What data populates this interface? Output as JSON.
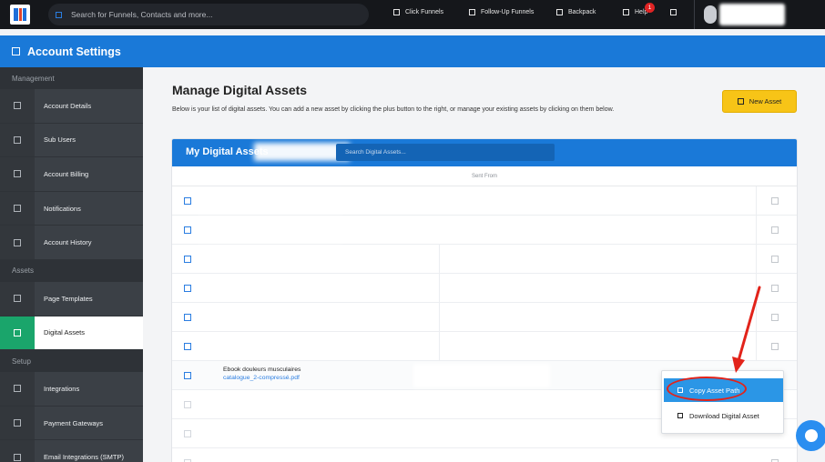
{
  "topnav": {
    "search_placeholder": "Search for Funnels, Contacts and more...",
    "items": [
      "Click Funnels",
      "Follow-Up Funnels",
      "Backpack",
      "Help",
      ""
    ],
    "help_badge": "1"
  },
  "header": {
    "title": "Account Settings"
  },
  "sidebar": {
    "sections": [
      {
        "label": "Management",
        "items": [
          "Account Details",
          "Sub Users",
          "Account Billing",
          "Notifications",
          "Account History"
        ]
      },
      {
        "label": "Assets",
        "items": [
          "Page Templates",
          "Digital Assets"
        ]
      },
      {
        "label": "Setup",
        "items": [
          "Integrations",
          "Payment Gateways",
          "Email Integrations (SMTP)"
        ]
      }
    ],
    "active": "Digital Assets"
  },
  "main": {
    "title": "Manage Digital Assets",
    "description": "Below is your list of digital assets. You can add a new asset by clicking the plus button to the right, or manage your existing assets by clicking on them below.",
    "new_asset_label": "New Asset"
  },
  "assets": {
    "card_title": "My Digital Assets",
    "search_placeholder": "Search Digital Assets...",
    "column_header": "Sent From",
    "file_name": "Ebook douleurs musculaires",
    "file_link": "catalogue_2-compressé.pdf"
  },
  "menu": {
    "copy_path": "Copy Asset Path",
    "download": "Download Digital Asset"
  },
  "colors": {
    "accent": "#1a79d8",
    "active_green": "#1aa56b",
    "button_yellow": "#f7c417",
    "annotation_red": "#e2231a"
  }
}
